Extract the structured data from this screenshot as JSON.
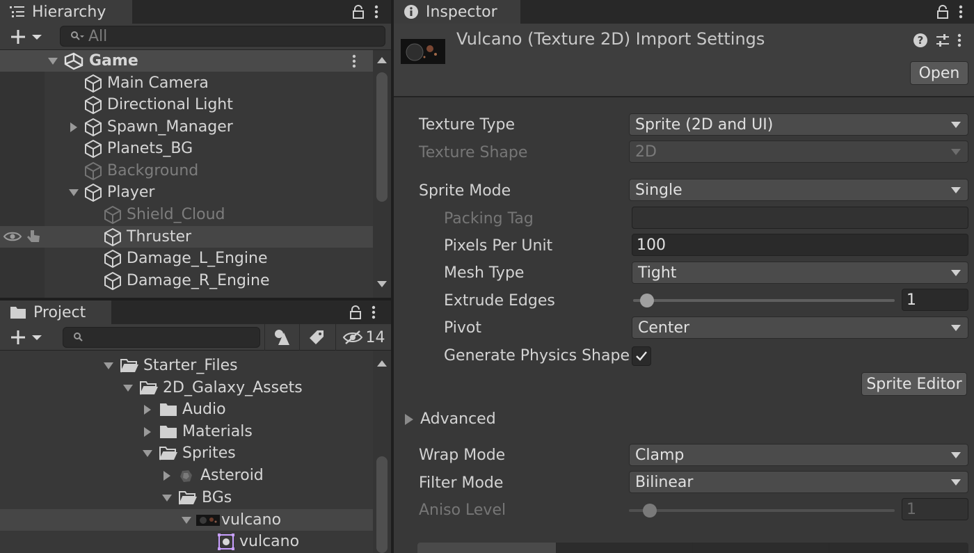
{
  "hierarchy": {
    "tab_label": "Hierarchy",
    "search_placeholder": "All",
    "scene_name": "Game",
    "items": [
      {
        "label": "Main Camera"
      },
      {
        "label": "Directional Light"
      },
      {
        "label": "Spawn_Manager"
      },
      {
        "label": "Planets_BG"
      },
      {
        "label": "Background"
      },
      {
        "label": "Player"
      },
      {
        "label": "Shield_Cloud"
      },
      {
        "label": "Thruster"
      },
      {
        "label": "Damage_L_Engine"
      },
      {
        "label": "Damage_R_Engine"
      }
    ]
  },
  "project": {
    "tab_label": "Project",
    "hidden_count": "14",
    "items": [
      {
        "label": "Starter_Files"
      },
      {
        "label": "2D_Galaxy_Assets"
      },
      {
        "label": "Audio"
      },
      {
        "label": "Materials"
      },
      {
        "label": "Sprites"
      },
      {
        "label": "Asteroid"
      },
      {
        "label": "BGs"
      },
      {
        "label": "vulcano"
      },
      {
        "label": "vulcano"
      }
    ]
  },
  "inspector": {
    "tab_label": "Inspector",
    "title": "Vulcano (Texture 2D) Import Settings",
    "open_label": "Open",
    "texture_type_label": "Texture Type",
    "texture_type_value": "Sprite (2D and UI)",
    "texture_shape_label": "Texture Shape",
    "texture_shape_value": "2D",
    "sprite_mode_label": "Sprite Mode",
    "sprite_mode_value": "Single",
    "packing_tag_label": "Packing Tag",
    "packing_tag_value": "",
    "ppu_label": "Pixels Per Unit",
    "ppu_value": "100",
    "mesh_type_label": "Mesh Type",
    "mesh_type_value": "Tight",
    "extrude_label": "Extrude Edges",
    "extrude_value": "1",
    "pivot_label": "Pivot",
    "pivot_value": "Center",
    "physics_label": "Generate Physics Shape",
    "sprite_editor_label": "Sprite Editor",
    "advanced_label": "Advanced",
    "wrap_label": "Wrap Mode",
    "wrap_value": "Clamp",
    "filter_label": "Filter Mode",
    "filter_value": "Bilinear",
    "aniso_label": "Aniso Level",
    "aniso_value": "1"
  },
  "colors": {
    "panel_bg": "#383838",
    "selection": "#464646",
    "accent_sprite": "#c8a0ff"
  }
}
